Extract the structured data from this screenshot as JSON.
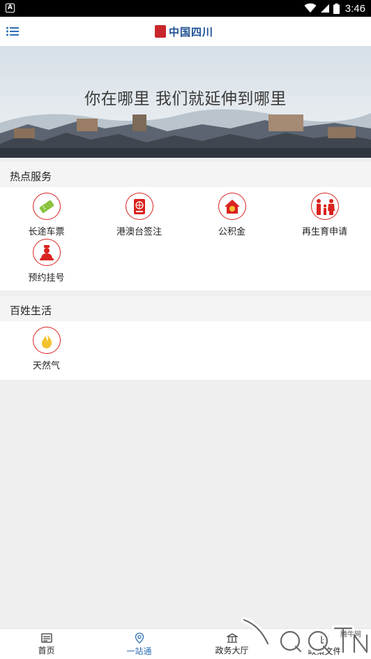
{
  "status_bar": {
    "time": "3:46",
    "notification_letter": "A"
  },
  "header": {
    "logo_text": "中国四川"
  },
  "banner": {
    "title": "你在哪里 我们就延伸到哪里"
  },
  "hot_services": {
    "title": "热点服务",
    "items": [
      {
        "label": "长途车票",
        "icon": "ticket-icon"
      },
      {
        "label": "港澳台签注",
        "icon": "passport-icon"
      },
      {
        "label": "公积金",
        "icon": "house-fund-icon"
      },
      {
        "label": "再生育申请",
        "icon": "family-icon"
      },
      {
        "label": "预约挂号",
        "icon": "doctor-icon"
      }
    ]
  },
  "daily_life": {
    "title": "百姓生活",
    "items": [
      {
        "label": "天然气",
        "icon": "gas-flame-icon"
      }
    ]
  },
  "bottom_nav": {
    "active": 1,
    "items": [
      {
        "label": "首页",
        "icon": "news-icon"
      },
      {
        "label": "一站通",
        "icon": "location-pin-icon"
      },
      {
        "label": "政务大厅",
        "icon": "hall-icon"
      },
      {
        "label": "政策文件",
        "icon": "document-icon"
      }
    ]
  },
  "watermark": {
    "site": "腾牛网",
    "brand": "QQTN"
  },
  "colors": {
    "accent_red": "#d9231f",
    "nav_active": "#2f6fb6",
    "logo_blue": "#1d4f91"
  }
}
